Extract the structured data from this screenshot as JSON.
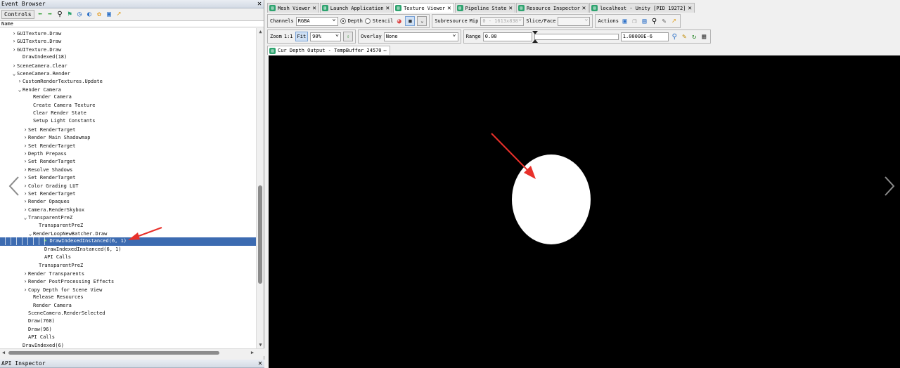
{
  "event_browser": {
    "title": "Event Browser",
    "close": "✕",
    "controls_label": "Controls",
    "column_name": "Name",
    "rows": [
      {
        "label": "GUITexture.Draw",
        "chev": "›"
      },
      {
        "label": "GUITexture.Draw",
        "chev": "›"
      },
      {
        "label": "GUITexture.Draw",
        "chev": "›"
      },
      {
        "label": "DrawIndexed(18)",
        "chev": ""
      },
      {
        "label": "SceneCamera.Clear",
        "chev": "›"
      },
      {
        "label": "SceneCamera.Render",
        "chev": "⌄"
      },
      {
        "label": "CustomRenderTextures.Update",
        "chev": "›"
      },
      {
        "label": "Render Camera",
        "chev": "⌄"
      },
      {
        "label": "Render Camera",
        "chev": ""
      },
      {
        "label": "Create Camera Texture",
        "chev": ""
      },
      {
        "label": "Clear Render State",
        "chev": ""
      },
      {
        "label": "Setup Light Constants",
        "chev": ""
      },
      {
        "label": "Set RenderTarget",
        "chev": "›"
      },
      {
        "label": "Render Main Shadowmap",
        "chev": "›"
      },
      {
        "label": "Set RenderTarget",
        "chev": "›"
      },
      {
        "label": "Depth Prepass",
        "chev": "›"
      },
      {
        "label": "Set RenderTarget",
        "chev": "›"
      },
      {
        "label": "Resolve Shadows",
        "chev": "›"
      },
      {
        "label": "Set RenderTarget",
        "chev": "›"
      },
      {
        "label": "Color Grading LUT",
        "chev": "›"
      },
      {
        "label": "Set RenderTarget",
        "chev": "›"
      },
      {
        "label": "Render Opaques",
        "chev": "›"
      },
      {
        "label": "Camera.RenderSkybox",
        "chev": "›"
      },
      {
        "label": "TransparentPreZ",
        "chev": "⌄"
      },
      {
        "label": "TransparentPreZ",
        "chev": ""
      },
      {
        "label": "RenderLoopNewBatcher.Draw",
        "chev": "⌄"
      },
      {
        "label": "DrawIndexedInstanced(6, 1)",
        "chev": ""
      },
      {
        "label": "DrawIndexedInstanced(6, 1)",
        "chev": ""
      },
      {
        "label": "API Calls",
        "chev": ""
      },
      {
        "label": "TransparentPreZ",
        "chev": ""
      },
      {
        "label": "Render Transparents",
        "chev": "›"
      },
      {
        "label": "Render PostProcessing Effects",
        "chev": "›"
      },
      {
        "label": "Copy Depth for Scene View",
        "chev": "›"
      },
      {
        "label": "Release Resources",
        "chev": ""
      },
      {
        "label": "Render Camera",
        "chev": ""
      },
      {
        "label": "SceneCamera.RenderSelected",
        "chev": ""
      },
      {
        "label": "Draw(768)",
        "chev": ""
      },
      {
        "label": "Draw(96)",
        "chev": ""
      },
      {
        "label": "API Calls",
        "chev": ""
      },
      {
        "label": "DrawIndexed(6)",
        "chev": ""
      }
    ]
  },
  "api_inspector": {
    "title": "API Inspector",
    "close": "✕"
  },
  "tabs": [
    {
      "label": "Mesh Viewer",
      "active": false
    },
    {
      "label": "Launch Application",
      "active": false
    },
    {
      "label": "Texture Viewer",
      "active": true
    },
    {
      "label": "Pipeline State",
      "active": false
    },
    {
      "label": "Resource Inspector",
      "active": false
    },
    {
      "label": "localhost - Unity [PID 19272]",
      "active": false
    }
  ],
  "toolbar": {
    "channels_label": "Channels",
    "channels_value": "RGBA",
    "depth_label": "Depth",
    "stencil_label": "Stencil",
    "subresource_label": "Subresource",
    "mip_label": "Mip",
    "mip_value": "0 - 1613x838",
    "slice_label": "Slice/Face",
    "slice_value": "",
    "actions_label": "Actions",
    "zoom_label": "Zoom",
    "zoom_ratio": "1:1",
    "fit_label": "Fit",
    "zoom_value": "90%",
    "overlay_label": "Overlay",
    "overlay_value": "None",
    "range_label": "Range",
    "range_min": "0.00",
    "range_max": "1.00000E-6"
  },
  "subtab": {
    "label": "Cur Depth Output - TempBuffer 24570",
    "more": "⋯"
  },
  "colors": {
    "accent": "#3c6bb1",
    "viewport_bg": "#000000",
    "tab_icon": "#2ea36f",
    "arrow": "#e8302a"
  }
}
